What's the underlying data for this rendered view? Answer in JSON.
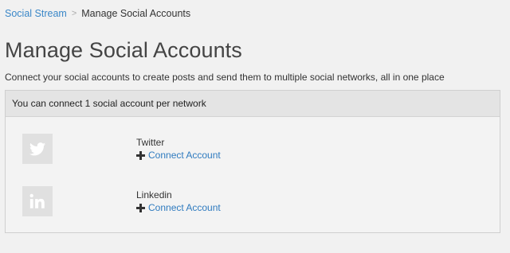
{
  "breadcrumb": {
    "link_label": "Social Stream",
    "separator": ">",
    "current_label": "Manage Social Accounts"
  },
  "header": {
    "title": "Manage Social Accounts",
    "description": "Connect your social accounts to create posts and send them to multiple social networks, all in one place"
  },
  "panel": {
    "header_text": "You can connect 1 social account per network",
    "accounts": [
      {
        "network": "Twitter",
        "icon": "twitter-icon",
        "connect_label": "Connect Account"
      },
      {
        "network": "Linkedin",
        "icon": "linkedin-icon",
        "connect_label": "Connect Account"
      }
    ]
  },
  "colors": {
    "background": "#f1f1f1",
    "link": "#2f7bbf",
    "panel_header": "#e4e4e4",
    "icon_tile": "#e0e0e0"
  }
}
